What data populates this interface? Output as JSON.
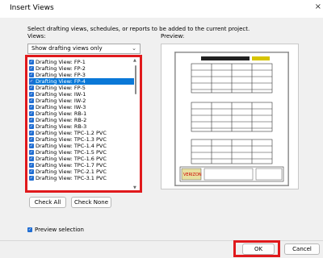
{
  "window": {
    "title": "Insert Views",
    "close_glyph": "×"
  },
  "instruction": "Select drafting views, schedules, or reports to be added to the current project.",
  "views_label": "Views:",
  "preview_label": "Preview:",
  "filter": {
    "selected": "Show drafting views only"
  },
  "views": [
    {
      "label": "Drafting View: FP-1",
      "checked": true,
      "selected": false
    },
    {
      "label": "Drafting View: FP-2",
      "checked": true,
      "selected": false
    },
    {
      "label": "Drafting View: FP-3",
      "checked": true,
      "selected": false
    },
    {
      "label": "Drafting View: FP-4",
      "checked": true,
      "selected": true
    },
    {
      "label": "Drafting View: FP-5",
      "checked": true,
      "selected": false
    },
    {
      "label": "Drafting View: IW-1",
      "checked": true,
      "selected": false
    },
    {
      "label": "Drafting View: IW-2",
      "checked": true,
      "selected": false
    },
    {
      "label": "Drafting View: IW-3",
      "checked": true,
      "selected": false
    },
    {
      "label": "Drafting View: RB-1",
      "checked": true,
      "selected": false
    },
    {
      "label": "Drafting View: RB-2",
      "checked": true,
      "selected": false
    },
    {
      "label": "Drafting View: RB-3",
      "checked": true,
      "selected": false
    },
    {
      "label": "Drafting View: TPC-1.2 PVC",
      "checked": true,
      "selected": false
    },
    {
      "label": "Drafting View: TPC-1.3 PVC",
      "checked": true,
      "selected": false
    },
    {
      "label": "Drafting View: TPC-1.4 PVC",
      "checked": true,
      "selected": false
    },
    {
      "label": "Drafting View: TPC-1.5 PVC",
      "checked": true,
      "selected": false
    },
    {
      "label": "Drafting View: TPC-1.6 PVC",
      "checked": true,
      "selected": false
    },
    {
      "label": "Drafting View: TPC-1.7 PVC",
      "checked": true,
      "selected": false
    },
    {
      "label": "Drafting View: TPC-2.1 PVC",
      "checked": true,
      "selected": false
    },
    {
      "label": "Drafting View: TPC-3.1 PVC",
      "checked": true,
      "selected": false
    }
  ],
  "buttons": {
    "check_all": "Check All",
    "check_none": "Check None",
    "ok": "OK",
    "cancel": "Cancel"
  },
  "preview_selection": {
    "label": "Preview selection",
    "checked": true
  },
  "preview_logo": "VERIZON",
  "highlight_color": "#e0191c",
  "selection_color": "#0a78d7",
  "checkbox_color": "#1f6dd2"
}
